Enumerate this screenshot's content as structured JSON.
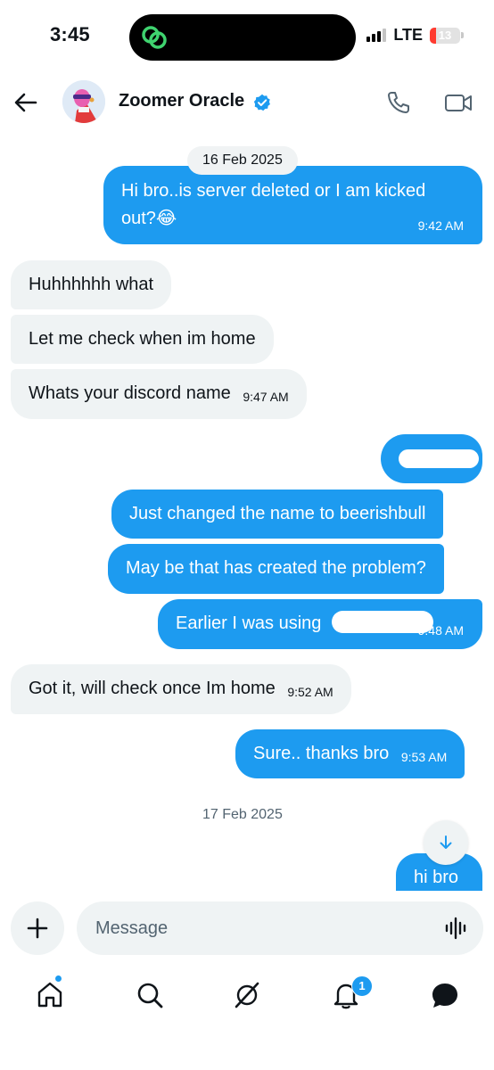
{
  "status_bar": {
    "time": "3:45",
    "network": "LTE",
    "battery": "13",
    "battery_level": 0.13
  },
  "header": {
    "contact_name": "Zoomer Oracle",
    "verified": true,
    "icons": [
      "back-arrow-icon",
      "avatar",
      "verified-badge-icon",
      "phone-icon",
      "video-camera-icon"
    ]
  },
  "messages": {
    "date1": "16 Feb 2025",
    "m1": {
      "text1": "Hi bro..is server deleted or I am kicked",
      "text2": "out?😂",
      "time": "9:42 AM"
    },
    "m2": {
      "text": "Huhhhhhh what"
    },
    "m3": {
      "text": "Let me check when im home"
    },
    "m4": {
      "text": "Whats your discord name",
      "time": "9:47 AM"
    },
    "m6": {
      "text": "Just changed the name to beerishbull"
    },
    "m7": {
      "text": "May be that has created the problem?"
    },
    "m8": {
      "text": "Earlier I was using",
      "time": "9:48 AM"
    },
    "m9": {
      "text": "Got it, will check once Im home",
      "time": "9:52 AM"
    },
    "m10": {
      "text": "Sure.. thanks bro",
      "time": "9:53 AM"
    },
    "date2": "17 Feb 2025",
    "m11": {
      "text": "hi bro"
    }
  },
  "composer": {
    "placeholder": "Message"
  },
  "tab_bar": {
    "items": [
      "home-icon",
      "search-icon",
      "grok-icon",
      "notifications-icon",
      "messages-icon"
    ],
    "notification_count": "1"
  },
  "colors": {
    "accent": "#1d9bf0",
    "incoming_bubble": "#eff3f4",
    "text": "#0f1419",
    "secondary_text": "#536471"
  }
}
